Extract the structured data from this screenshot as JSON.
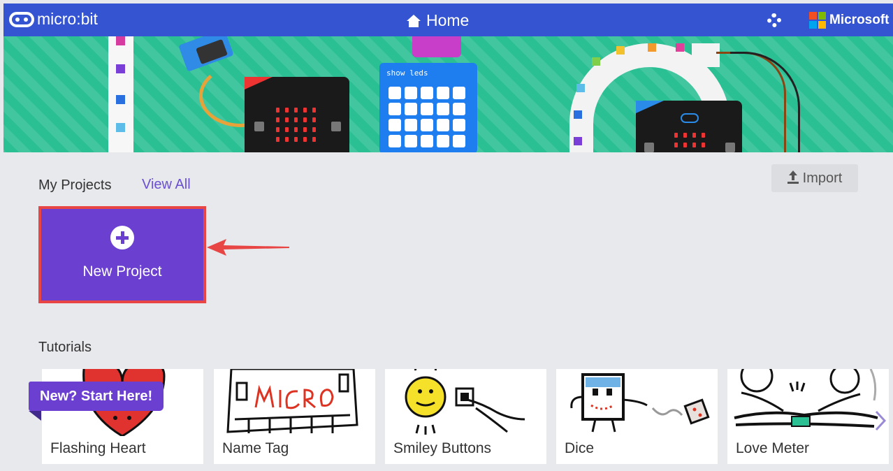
{
  "header": {
    "brand": "micro:bit",
    "title": "Home",
    "account": "Microsoft"
  },
  "banner": {
    "code_label": "show leds"
  },
  "projects": {
    "heading": "My Projects",
    "view_all": "View All",
    "import_label": "Import",
    "new_project_label": "New Project"
  },
  "tutorials": {
    "heading": "Tutorials",
    "badge": "New? Start Here!",
    "items": [
      {
        "label": "Flashing Heart"
      },
      {
        "label": "Name Tag"
      },
      {
        "label": "Smiley Buttons"
      },
      {
        "label": "Dice"
      },
      {
        "label": "Love Meter"
      }
    ]
  },
  "colors": {
    "header_bg": "#3454d1",
    "accent_purple": "#6b3fcf",
    "highlight_red": "#e84545",
    "banner_green": "#2bbf94"
  }
}
